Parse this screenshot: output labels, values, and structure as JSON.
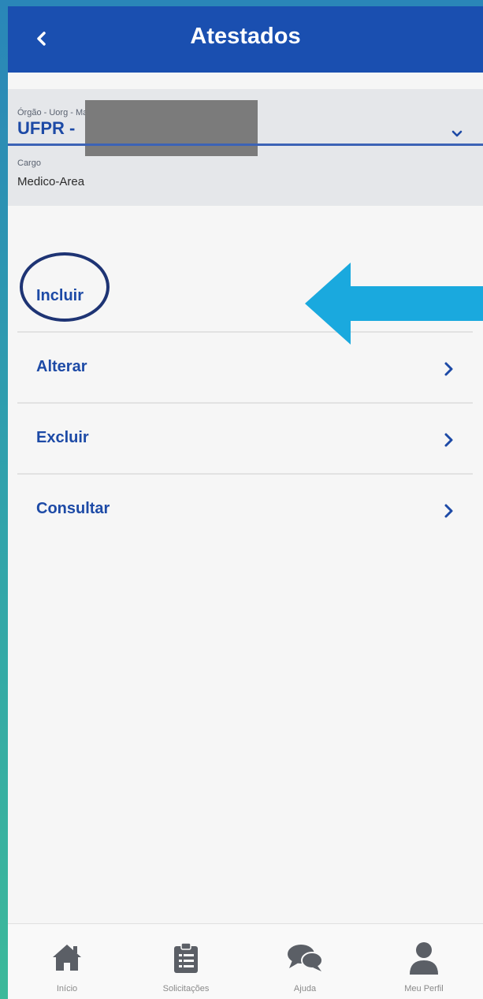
{
  "appbar": {
    "title": "Atestados",
    "back_icon": "chevron-left-icon"
  },
  "selector": {
    "orgao_label": "Órgão - Uorg - Matrícula",
    "orgao_value": "UFPR -",
    "cargo_label": "Cargo",
    "cargo_value": "Medico-Area",
    "dropdown_icon": "chevron-down-icon"
  },
  "menu": {
    "items": [
      {
        "label": "Incluir",
        "has_chevron": false
      },
      {
        "label": "Alterar",
        "has_chevron": true
      },
      {
        "label": "Excluir",
        "has_chevron": true
      },
      {
        "label": "Consultar",
        "has_chevron": true
      }
    ]
  },
  "annotations": {
    "circle_color": "#1e3474",
    "arrow_color": "#1aa9de"
  },
  "bottom_nav": {
    "items": [
      {
        "label": "Início",
        "icon": "home-icon"
      },
      {
        "label": "Solicitações",
        "icon": "clipboard-icon"
      },
      {
        "label": "Ajuda",
        "icon": "chat-bubbles-icon"
      },
      {
        "label": "Meu Perfil",
        "icon": "user-icon"
      }
    ]
  },
  "colors": {
    "header": "#1a4fb0",
    "accent": "#1d4aa6",
    "background": "#f6f6f6"
  }
}
